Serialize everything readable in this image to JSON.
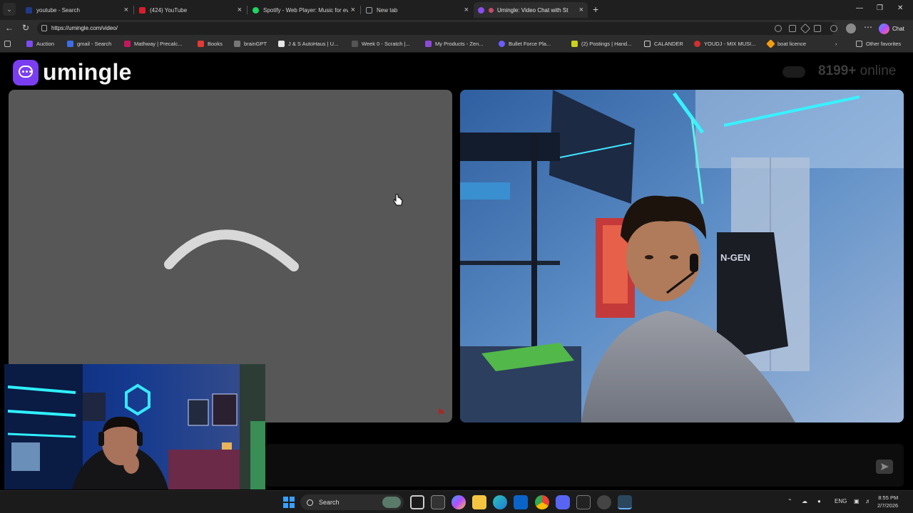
{
  "browser": {
    "tabs": [
      {
        "title": "youtube - Search",
        "favicon_color": "#1e3a8a",
        "active": false
      },
      {
        "title": "(424) YouTube",
        "favicon_color": "#d81e2c",
        "active": false
      },
      {
        "title": "Spotify - Web Player: Music for ev",
        "favicon_color": "#1ed760",
        "active": false
      },
      {
        "title": "New tab",
        "favicon_color": "#9aa0a6",
        "active": false
      },
      {
        "title": "Umingle: Video Chat with St",
        "favicon_color": "#8a4df0",
        "active": true
      }
    ],
    "new_tab_label": "+",
    "url": "https://umingle.com/video/",
    "bookmarks": [
      {
        "label": "Auction",
        "color": "#7a4df0"
      },
      {
        "label": "gmail - Search",
        "color": "#3d6ee6"
      },
      {
        "label": "Mathway | Precalc...",
        "color": "#c2185b"
      },
      {
        "label": "Books",
        "color": "#e53935"
      },
      {
        "label": "brainGPT",
        "color": "#777777"
      },
      {
        "label": "J & S AutoHaus | U...",
        "color": "#e6e6e6"
      },
      {
        "label": "Week 0 - Scratch |...",
        "color": "#555555"
      },
      {
        "label": "My Products - Zen...",
        "color": "#8c4bd6"
      },
      {
        "label": "Bullet Force  Pla...",
        "color": "#6d5cff"
      },
      {
        "label": "(2) Postings | Hand...",
        "color": "#c9d21d"
      },
      {
        "label": "CALANDER",
        "color": "#cfcfcf"
      },
      {
        "label": "YOUDJ - MIX MUSI...",
        "color": "#d32f2f"
      },
      {
        "label": "boat licence",
        "color": "#f39c12"
      }
    ],
    "other_favorites": "Other favorites",
    "chat_label": "Chat"
  },
  "site": {
    "logo_text": "umingle",
    "online_count": "8199+",
    "online_label": "online",
    "brand_color": "#7a3ef0"
  },
  "taskbar": {
    "search_label": "Search",
    "language": "ENG",
    "time": "8:55 PM",
    "date": "2/7/2026"
  }
}
